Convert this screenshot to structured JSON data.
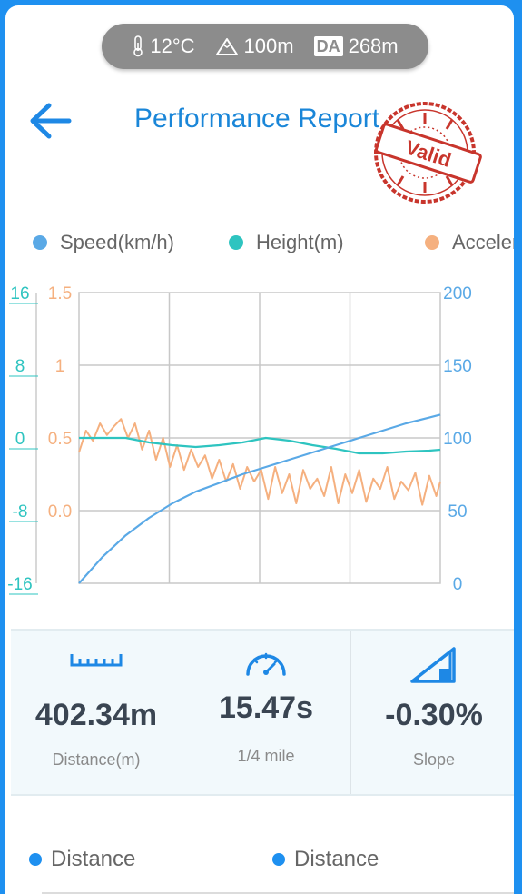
{
  "conditions": {
    "temperature": "12°C",
    "altitude": "100m",
    "da_badge": "DA",
    "density_altitude": "268m"
  },
  "header": {
    "title": "Performance Report",
    "stamp_text": "Valid",
    "back_icon": "arrow-left-icon"
  },
  "legend": [
    {
      "label": "Speed(km/h)",
      "color": "#5aa9e6"
    },
    {
      "label": "Height(m)",
      "color": "#2ec4c0"
    },
    {
      "label": "Acceleration",
      "color": "#f5b07f"
    }
  ],
  "chart_data": {
    "type": "line",
    "grid": true,
    "axes": {
      "height_left": {
        "ticks": [
          "16",
          "8",
          "0",
          "-8",
          "-16"
        ],
        "range": [
          -16,
          16
        ],
        "color": "#2ec4c0"
      },
      "accel_left": {
        "ticks": [
          "1.5",
          "1",
          "0.5",
          "0.0"
        ],
        "range": [
          -0.5,
          1.5
        ],
        "color": "#f5b07f"
      },
      "speed_right": {
        "ticks": [
          "200",
          "150",
          "100",
          "50",
          "0"
        ],
        "range": [
          0,
          200
        ],
        "color": "#5aa9e6"
      }
    },
    "x_range": [
      0,
      15.47
    ],
    "series": [
      {
        "name": "Speed(km/h)",
        "axis": "speed_right",
        "color": "#5aa9e6",
        "x": [
          0,
          1,
          2,
          3,
          4,
          5,
          6,
          7,
          8,
          9,
          10,
          11,
          12,
          13,
          14,
          15,
          15.47
        ],
        "values": [
          0,
          18,
          33,
          45,
          55,
          63,
          69,
          75,
          80,
          85,
          90,
          95,
          100,
          105,
          110,
          114,
          116
        ]
      },
      {
        "name": "Height(m)",
        "axis": "height_left",
        "color": "#2ec4c0",
        "x": [
          0,
          2,
          3,
          4,
          5,
          6,
          7,
          8,
          9,
          10,
          11,
          12,
          13,
          14,
          15,
          15.47
        ],
        "values": [
          0,
          0,
          -0.5,
          -0.8,
          -1,
          -0.8,
          -0.5,
          0,
          -0.3,
          -0.8,
          -1.2,
          -1.7,
          -1.7,
          -1.5,
          -1.4,
          -1.3
        ]
      },
      {
        "name": "Acceleration",
        "axis": "accel_left",
        "color": "#f5b07f",
        "x": [
          0,
          0.3,
          0.6,
          0.9,
          1.2,
          1.5,
          1.8,
          2.1,
          2.4,
          2.7,
          3,
          3.3,
          3.6,
          3.9,
          4.2,
          4.5,
          4.8,
          5.1,
          5.4,
          5.7,
          6,
          6.3,
          6.6,
          6.9,
          7.2,
          7.5,
          7.8,
          8.1,
          8.4,
          8.7,
          9,
          9.3,
          9.6,
          9.9,
          10.2,
          10.5,
          10.8,
          11.1,
          11.4,
          11.7,
          12,
          12.3,
          12.6,
          12.9,
          13.2,
          13.5,
          13.8,
          14.1,
          14.4,
          14.7,
          15,
          15.3,
          15.47
        ],
        "values": [
          0.4,
          0.55,
          0.48,
          0.6,
          0.52,
          0.58,
          0.63,
          0.5,
          0.6,
          0.42,
          0.55,
          0.35,
          0.5,
          0.3,
          0.45,
          0.28,
          0.42,
          0.3,
          0.38,
          0.22,
          0.35,
          0.2,
          0.32,
          0.15,
          0.3,
          0.2,
          0.28,
          0.08,
          0.3,
          0.12,
          0.25,
          0.05,
          0.28,
          0.15,
          0.22,
          0.1,
          0.3,
          0.05,
          0.25,
          0.12,
          0.28,
          0.06,
          0.22,
          0.15,
          0.3,
          0.08,
          0.2,
          0.14,
          0.26,
          0.04,
          0.24,
          0.1,
          0.2
        ]
      }
    ]
  },
  "stats": [
    {
      "value": "402.34m",
      "label": "Distance(m)",
      "icon": "ruler-icon"
    },
    {
      "value": "15.47s",
      "label": "1/4 mile",
      "icon": "speedometer-icon"
    },
    {
      "value": "-0.30%",
      "label": "Slope",
      "icon": "slope-icon"
    }
  ],
  "bottom_legend": [
    {
      "label": "Distance"
    },
    {
      "label": "Distance"
    }
  ]
}
